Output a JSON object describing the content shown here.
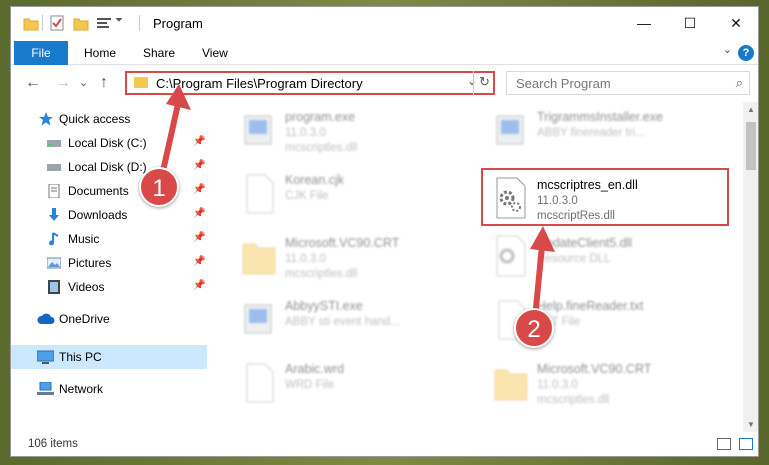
{
  "window": {
    "title": "Program",
    "minimize": "—",
    "maximize": "☐",
    "close": "✕"
  },
  "ribbon": {
    "file": "File",
    "home": "Home",
    "share": "Share",
    "view": "View",
    "help": "?"
  },
  "address": {
    "path": "C:\\Program Files\\Program Directory",
    "dropdown": "⌄",
    "refresh": "↻"
  },
  "search": {
    "placeholder": "Search Program",
    "icon": "⌕"
  },
  "nav": {
    "back": "←",
    "forward": "→",
    "history": "⌄",
    "up": "↑"
  },
  "sidebar": {
    "items": [
      {
        "label": "Quick access",
        "icon": "star-icon"
      },
      {
        "label": "Local Disk (C:)",
        "icon": "drive-icon",
        "pinned": true
      },
      {
        "label": "Local Disk (D:)",
        "icon": "drive-icon",
        "pinned": true
      },
      {
        "label": "Documents",
        "icon": "documents-icon",
        "pinned": true
      },
      {
        "label": "Downloads",
        "icon": "download-icon",
        "pinned": true
      },
      {
        "label": "Music",
        "icon": "music-icon",
        "pinned": true
      },
      {
        "label": "Pictures",
        "icon": "pictures-icon",
        "pinned": true
      },
      {
        "label": "Videos",
        "icon": "videos-icon",
        "pinned": true
      },
      {
        "label": "OneDrive",
        "icon": "cloud-icon"
      },
      {
        "label": "This PC",
        "icon": "computer-icon",
        "selected": true
      },
      {
        "label": "Network",
        "icon": "network-icon"
      }
    ]
  },
  "files": {
    "left": [
      {
        "name": "program.exe",
        "line1": "11.0.3.0",
        "line2": "mcscriptles.dll"
      },
      {
        "name": "Korean.cjk",
        "line1": "CJK File",
        "line2": ""
      },
      {
        "name": "Microsoft.VC90.CRT",
        "line1": "11.0.3.0",
        "line2": "mcscriptles.dll"
      },
      {
        "name": "AbbyySTI.exe",
        "line1": "ABBY sti event hand...",
        "line2": ""
      },
      {
        "name": "Arabic.wrd",
        "line1": "WRD File",
        "line2": ""
      }
    ],
    "right": [
      {
        "name": "TrigrammsInstaller.exe",
        "line1": "ABBY finereader tri...",
        "line2": ""
      },
      {
        "name": "mcscriptres_en.dll",
        "line1": "11.0.3.0",
        "line2": "mcscriptRes.dll"
      },
      {
        "name": "UpdateClient5.dll",
        "line1": "Resource DLL",
        "line2": ""
      },
      {
        "name": "Help.fineReader.txt",
        "line1": "TXT File",
        "line2": ""
      },
      {
        "name": "Microsoft.VC90.CRT",
        "line1": "11.0.3.0",
        "line2": "mcscriptles.dll"
      }
    ]
  },
  "status": {
    "count": "106 items"
  },
  "annotations": {
    "step1": "1",
    "step2": "2",
    "color": "#d94949"
  }
}
